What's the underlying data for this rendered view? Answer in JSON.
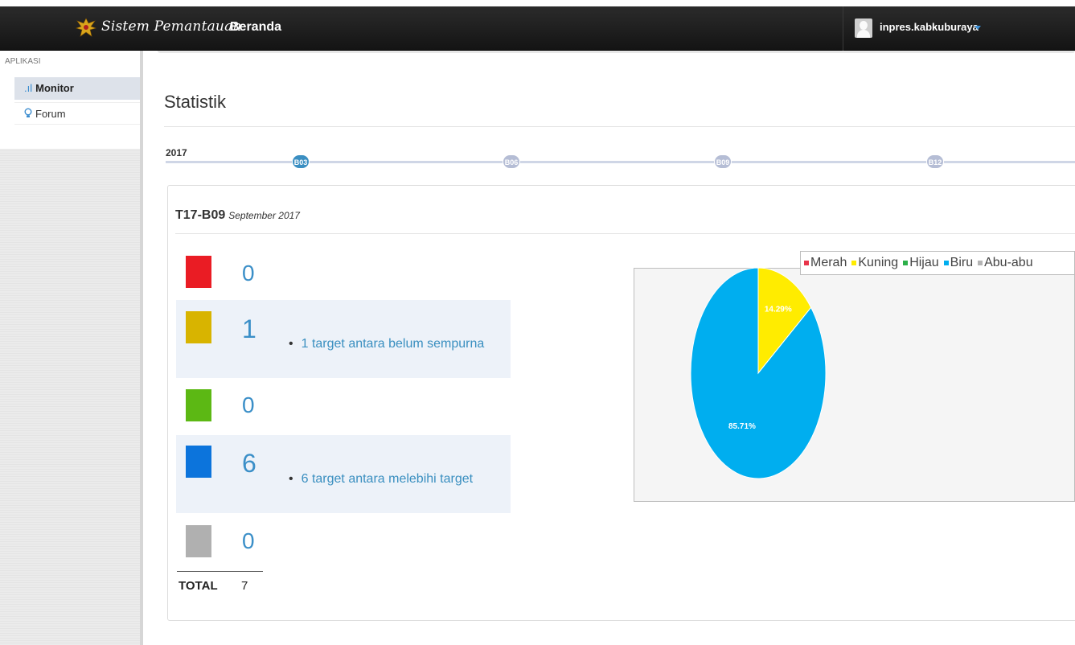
{
  "header": {
    "brand": "Sistem Pemantauan",
    "page": "Beranda",
    "username": "inpres.kabkuburaya"
  },
  "sidebar": {
    "section_label": "APLIKASI",
    "items": [
      {
        "label": "Monitor",
        "icon": "signal-bars-icon",
        "active": true
      },
      {
        "label": "Forum",
        "icon": "lightbulb-icon",
        "active": false
      }
    ]
  },
  "main": {
    "title": "Statistik",
    "timeline": {
      "year": "2017",
      "nodes": [
        "B03",
        "B06",
        "B09",
        "B12"
      ],
      "active_node": "B03"
    },
    "panel": {
      "code": "T17-B09",
      "period": "September 2017",
      "rows": [
        {
          "color": "#ea1c24",
          "count": "0",
          "note": ""
        },
        {
          "color": "#d8b400",
          "count": "1",
          "note": "1 target antara belum sempurna"
        },
        {
          "color": "#5cb814",
          "count": "0",
          "note": ""
        },
        {
          "color": "#0c74dc",
          "count": "6",
          "note": "6 target antara melebihi target"
        },
        {
          "color": "#b0b0b0",
          "count": "0",
          "note": ""
        }
      ],
      "total_label": "TOTAL",
      "total_value": "7"
    }
  },
  "chart_data": {
    "type": "pie",
    "legend_position": "top-right",
    "slices": [
      {
        "label": "Merah",
        "value": 0,
        "color": "#e8344a"
      },
      {
        "label": "Kuning",
        "value": 14.29,
        "color": "#ffec00",
        "data_label": "14.29%"
      },
      {
        "label": "Hijau",
        "value": 0,
        "color": "#2cb049"
      },
      {
        "label": "Biru",
        "value": 85.71,
        "color": "#00aeef",
        "data_label": "85.71%"
      },
      {
        "label": "Abu-abu",
        "value": 0,
        "color": "#b4b4b4"
      }
    ]
  }
}
